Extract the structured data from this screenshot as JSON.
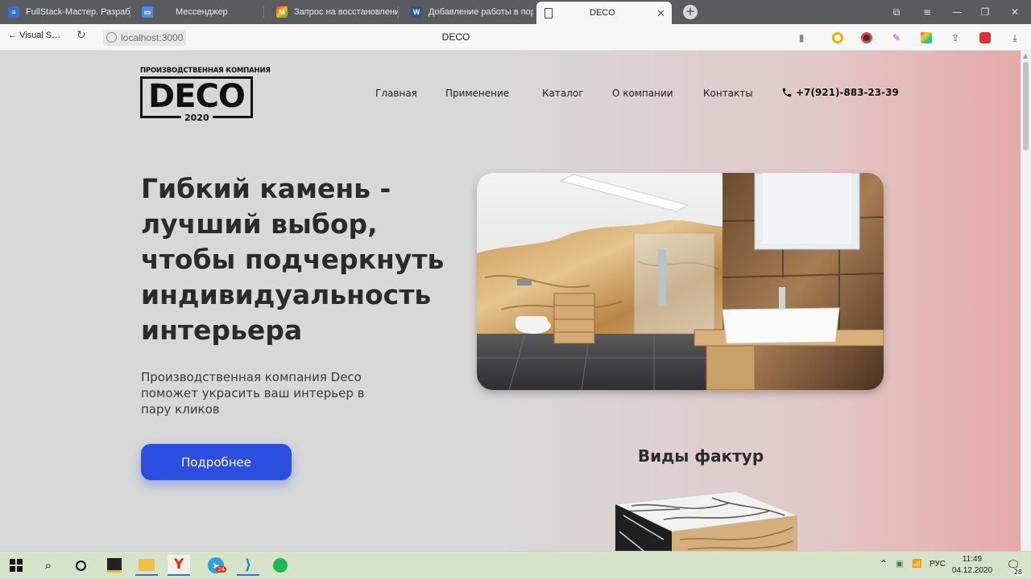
{
  "browser": {
    "tabs": [
      {
        "label": "FullStack-Мастер. Разраб",
        "favicon": "doc"
      },
      {
        "label": "Мессенджер",
        "favicon": "chat"
      },
      {
        "label": "Запрос на восстановлени",
        "favicon": "gmail"
      },
      {
        "label": "Добавление работы в пор",
        "favicon": "W"
      },
      {
        "label": "DECO",
        "favicon": "page"
      }
    ],
    "back_label": "Visual S…",
    "url": "localhost:3000",
    "page_title": "DECO"
  },
  "site": {
    "logo": {
      "caption": "ПРОИЗВОДСТВЕННАЯ КОМПАНИЯ",
      "word": "DECO",
      "year": "2020"
    },
    "nav": [
      "Главная",
      "Применение",
      "Каталог",
      "О компании",
      "Контакты"
    ],
    "phone": "+7(921)-883-23-39",
    "hero_title": "Гибкий камень - лучший выбор, чтобы подчеркнуть индивидуальность интерьера",
    "hero_subtitle": "Производственная компания Deco поможет украсить ваш интерьер в пару кликов",
    "cta_label": "Подробнее",
    "textures_title": "Виды фактур"
  },
  "taskbar": {
    "lang": "РУС",
    "time": "11:49",
    "date": "04.12.2020",
    "telegram_badge": "24",
    "notifications": "28"
  },
  "colors": {
    "accent": "#2b4ee0",
    "tab_strip": "#5a5b5e",
    "page_left": "#d8d8d8",
    "page_right": "#e6a9a9"
  }
}
